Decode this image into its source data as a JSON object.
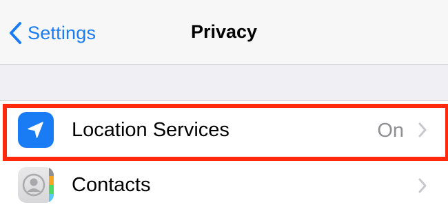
{
  "navbar": {
    "back_label": "Settings",
    "title": "Privacy"
  },
  "rows": [
    {
      "label": "Location Services",
      "value": "On",
      "icon": "location-arrow-icon",
      "icon_color": "#1a7cf5"
    },
    {
      "label": "Contacts",
      "value": "",
      "icon": "contacts-icon"
    }
  ],
  "colors": {
    "accent": "#1a7cf5",
    "highlight": "#ff2a0e",
    "secondary_text": "#8e8e93"
  }
}
